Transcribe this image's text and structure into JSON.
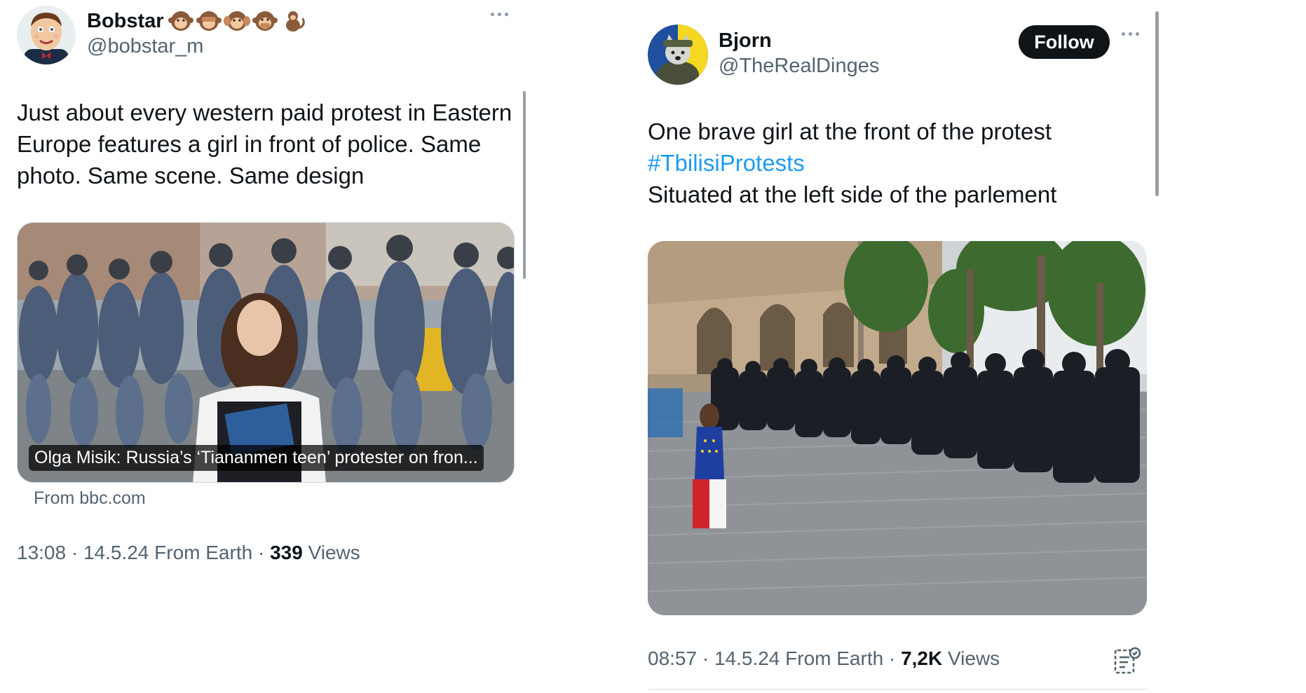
{
  "left_tweet": {
    "display_name": "Bobstar",
    "name_emojis": [
      "🐵",
      "🙈",
      "🙉",
      "🙊",
      "🐒"
    ],
    "handle": "@bobstar_m",
    "text": "Just about every western paid protest in Eastern Europe features a girl in front of police. Same photo. Same scene. Same design",
    "link_card": {
      "caption": "Olga Misik: Russia’s ‘Tiananmen teen’ protester on fron...",
      "source": "From bbc.com"
    },
    "meta": {
      "time_date": "13:08 · 14.5.24 From Earth ·",
      "views_count": "339",
      "views_label": "Views"
    }
  },
  "right_tweet": {
    "display_name": "Bjorn",
    "handle": "@TheRealDinges",
    "follow_label": "Follow",
    "text_line1": "One brave girl at the front of the protest",
    "hashtag": "#TbilisiProtests",
    "text_line3": "Situated at the left side of the parlement",
    "meta": {
      "time_date": "08:57 · 14.5.24 From Earth ·",
      "views_count": "7,2K",
      "views_label": "Views"
    }
  },
  "colors": {
    "text_primary": "#0f1419",
    "text_secondary": "#536471",
    "link": "#1d9bf0",
    "follow_bg": "#0f1419"
  },
  "icons": {
    "left_more": "more-horizontal-icon",
    "right_more": "more-horizontal-icon",
    "analytics": "post-analytics-icon"
  }
}
